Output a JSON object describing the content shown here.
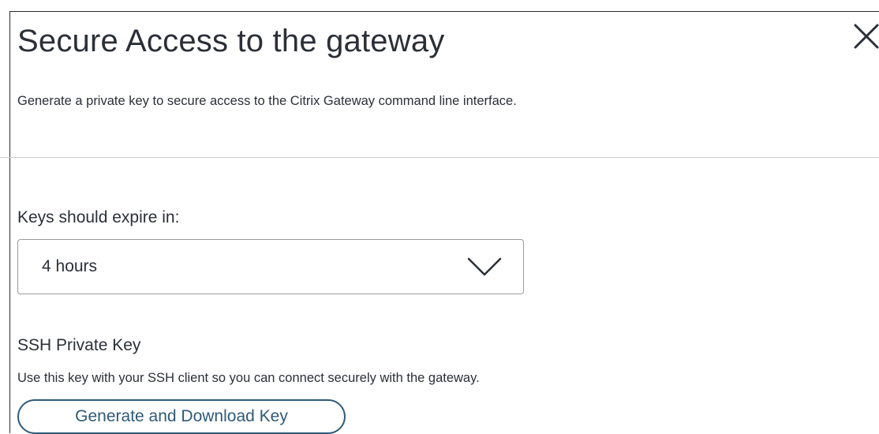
{
  "dialog": {
    "title": "Secure Access to the gateway",
    "subtitle": "Generate a private key to secure access to the Citrix Gateway command line interface.",
    "close_icon": "close-icon"
  },
  "expiry": {
    "label": "Keys should expire in:",
    "selected": "4 hours",
    "dropdown_icon": "chevron-down-icon"
  },
  "ssh": {
    "title": "SSH Private Key",
    "description": "Use this key with your SSH client so you can connect securely with the gateway.",
    "button_label": "Generate and Download Key"
  },
  "colors": {
    "text": "#2b2f38",
    "accent": "#2f5a78",
    "border": "#9a9a9a",
    "divider": "#d0d0d0"
  }
}
